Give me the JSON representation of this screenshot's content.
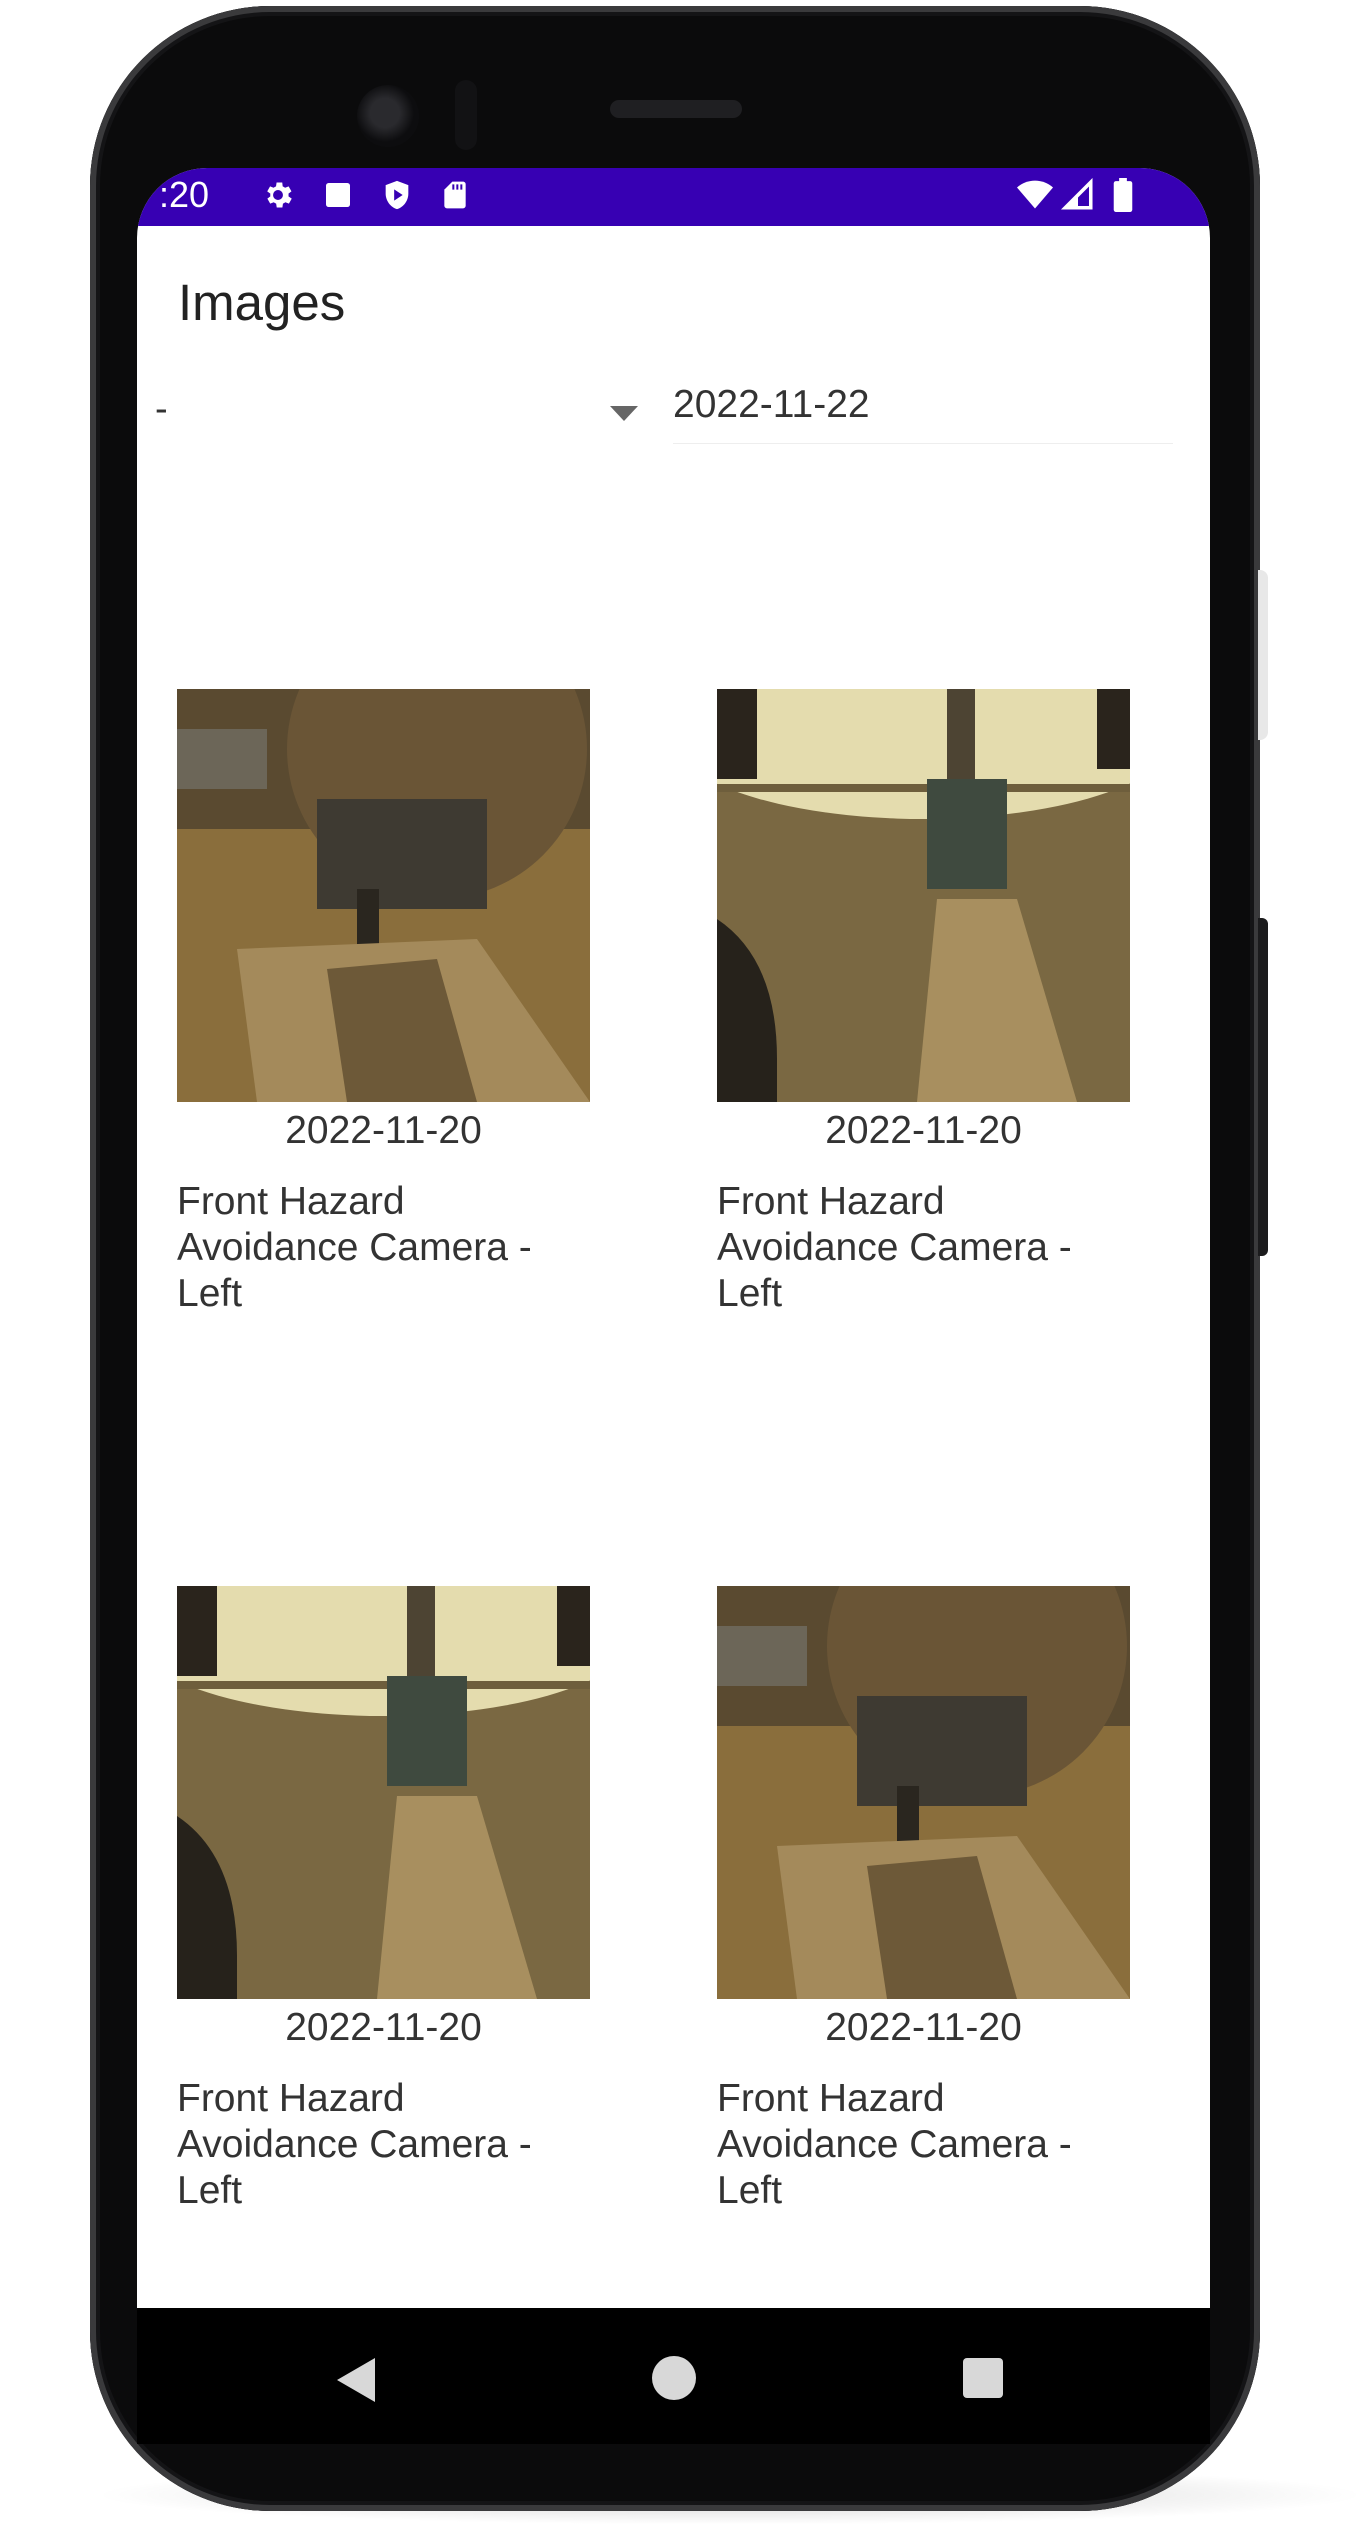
{
  "status_bar": {
    "time": ":20",
    "icons": [
      "gear-icon",
      "square-icon",
      "shield-play-icon",
      "sd-card-icon",
      "wifi-icon",
      "signal-icon",
      "battery-icon"
    ],
    "color": "#3700b3"
  },
  "page": {
    "title": "Images"
  },
  "filters": {
    "camera_select_value": "-",
    "date_value": "2022-11-22"
  },
  "images": [
    {
      "date": "2022-11-20",
      "camera": "Front Hazard Avoidance Camera - Left",
      "scene": "close-arm"
    },
    {
      "date": "2022-11-20",
      "camera": "Front Hazard Avoidance Camera - Left",
      "scene": "horizon-arm"
    },
    {
      "date": "2022-11-20",
      "camera": "Front Hazard Avoidance Camera - Left",
      "scene": "horizon-arm"
    },
    {
      "date": "2022-11-20",
      "camera": "Front Hazard Avoidance Camera - Left",
      "scene": "close-arm"
    }
  ],
  "nav": {
    "icons": [
      "back-icon",
      "home-icon",
      "recents-icon"
    ]
  }
}
